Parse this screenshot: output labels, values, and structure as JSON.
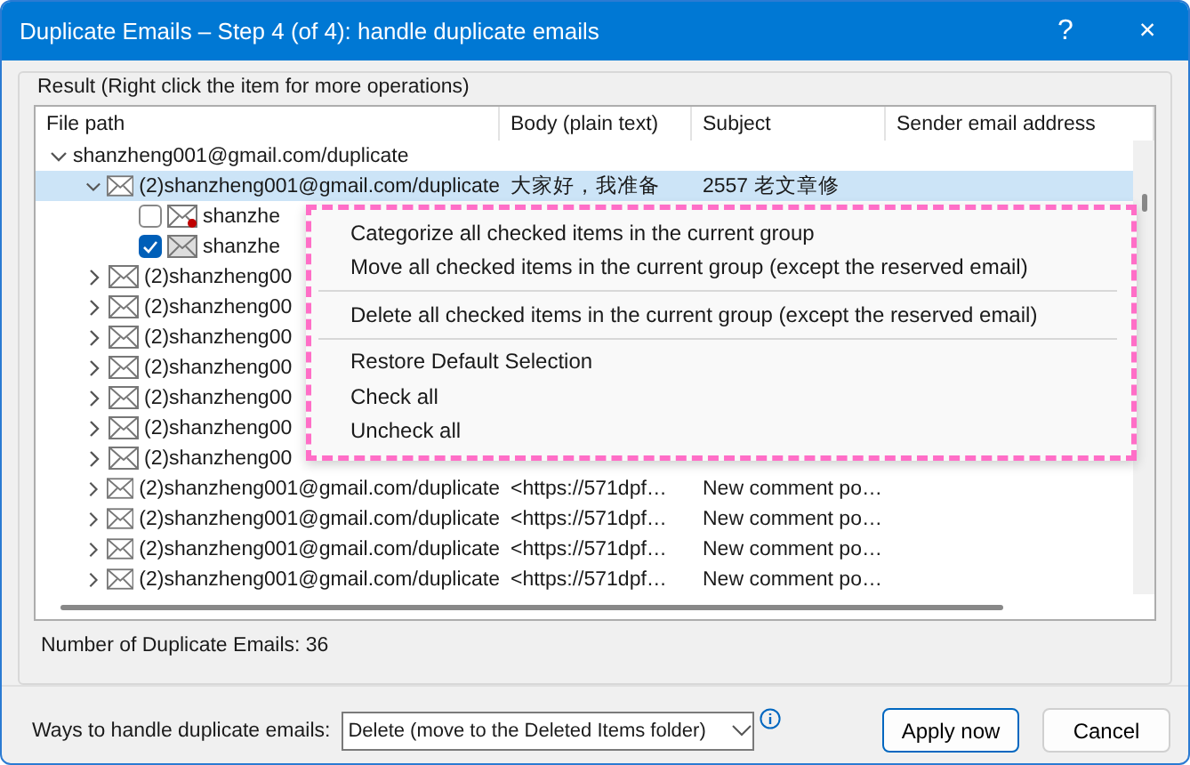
{
  "window": {
    "title": "Duplicate Emails – Step 4 (of 4): handle duplicate emails",
    "help": "?",
    "close": "×"
  },
  "result_group": {
    "legend": "Result (Right click the item for more operations)"
  },
  "tree": {
    "columns": [
      "File path",
      "Body (plain text)",
      "Subject",
      "Sender email address"
    ],
    "root": {
      "label": "shanzheng001@gmail.com/duplicate",
      "expanded": true,
      "children": [
        {
          "label": "(2)shanzheng001@gmail.com/duplicate",
          "body": "大家好，我准备",
          "subject": "2557 老文章修",
          "expanded": true,
          "selected": true,
          "children": [
            {
              "label": "shanzhe",
              "checked": false,
              "dot": true
            },
            {
              "label": "shanzhe",
              "checked": true,
              "dot": false
            }
          ]
        },
        {
          "label": "(2)shanzheng00",
          "expanded": false,
          "selected": false
        },
        {
          "label": "(2)shanzheng00",
          "expanded": false,
          "selected": false
        },
        {
          "label": "(2)shanzheng00",
          "expanded": false,
          "selected": false
        },
        {
          "label": "(2)shanzheng00",
          "expanded": false,
          "selected": false
        },
        {
          "label": "(2)shanzheng00",
          "expanded": false,
          "selected": false
        },
        {
          "label": "(2)shanzheng00",
          "expanded": false,
          "selected": false
        },
        {
          "label": "(2)shanzheng00",
          "expanded": false,
          "selected": false
        },
        {
          "label": "(2)shanzheng001@gmail.com/duplicate",
          "body": "<https://571dpf…",
          "subject": "New comment po…",
          "expanded": false,
          "selected": false
        },
        {
          "label": "(2)shanzheng001@gmail.com/duplicate",
          "body": "<https://571dpf…",
          "subject": "New comment po…",
          "expanded": false,
          "selected": false
        },
        {
          "label": "(2)shanzheng001@gmail.com/duplicate",
          "body": "<https://571dpf…",
          "subject": "New comment po…",
          "expanded": false,
          "selected": false
        },
        {
          "label": "(2)shanzheng001@gmail.com/duplicate",
          "body": "<https://571dpf…",
          "subject": "New comment po…",
          "expanded": false,
          "selected": false
        }
      ]
    }
  },
  "context_menu": {
    "sections": [
      [
        "Categorize all checked items in the current group",
        "Move all checked items in the current group (except the reserved email)"
      ],
      [
        "Delete all checked items in the current group (except the reserved email)"
      ],
      [
        "Restore Default Selection",
        "Check all",
        "Uncheck all"
      ]
    ]
  },
  "count": "Number of Duplicate Emails: 36",
  "footer": {
    "label": "Ways to handle duplicate emails:",
    "select": "Delete (move to the Deleted Items folder)",
    "buttons": [
      "Apply now",
      "Cancel"
    ]
  }
}
